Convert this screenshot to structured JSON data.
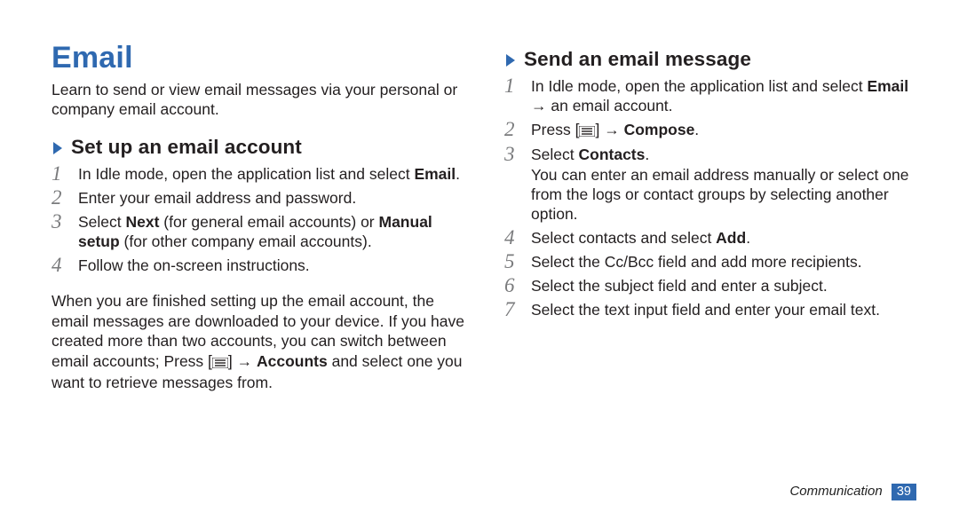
{
  "title": "Email",
  "intro": "Learn to send or view email messages via your personal or company email account.",
  "section_a": {
    "heading": "Set up an email account",
    "step1_pre": "In Idle mode, open the application list and select ",
    "step1_bold": "Email",
    "step1_post": ".",
    "step2": "Enter your email address and password.",
    "step3_pre": "Select ",
    "step3_b1": "Next",
    "step3_mid": " (for general email accounts) or ",
    "step3_b2": "Manual setup",
    "step3_post": " (for other company email accounts).",
    "step4": "Follow the on-screen instructions.",
    "para_pre": "When you are finished setting up the email account, the email messages are downloaded to your device. If you have created more than two accounts, you can switch between email accounts; Press [",
    "para_mid": "] → ",
    "para_bold": "Accounts",
    "para_post": " and select one you want to retrieve messages from."
  },
  "section_b": {
    "heading": "Send an email message",
    "step1_pre": "In Idle mode, open the application list and select ",
    "step1_bold": "Email",
    "step1_post": " → an email account.",
    "step2_pre": "Press [",
    "step2_mid": "] → ",
    "step2_bold": "Compose",
    "step2_post": ".",
    "step3_pre": "Select ",
    "step3_bold": "Contacts",
    "step3_post": ".",
    "step3_body": "You can enter an email address manually or select one from the logs or contact groups by selecting another option.",
    "step4_pre": "Select contacts and select ",
    "step4_bold": "Add",
    "step4_post": ".",
    "step5": "Select the Cc/Bcc field and add more recipients.",
    "step6": "Select the subject field and enter a subject.",
    "step7": "Select the text input field and enter your email text."
  },
  "footer": {
    "section": "Communication",
    "page": "39"
  },
  "numbers": {
    "n1": "1",
    "n2": "2",
    "n3": "3",
    "n4": "4",
    "n5": "5",
    "n6": "6",
    "n7": "7"
  }
}
